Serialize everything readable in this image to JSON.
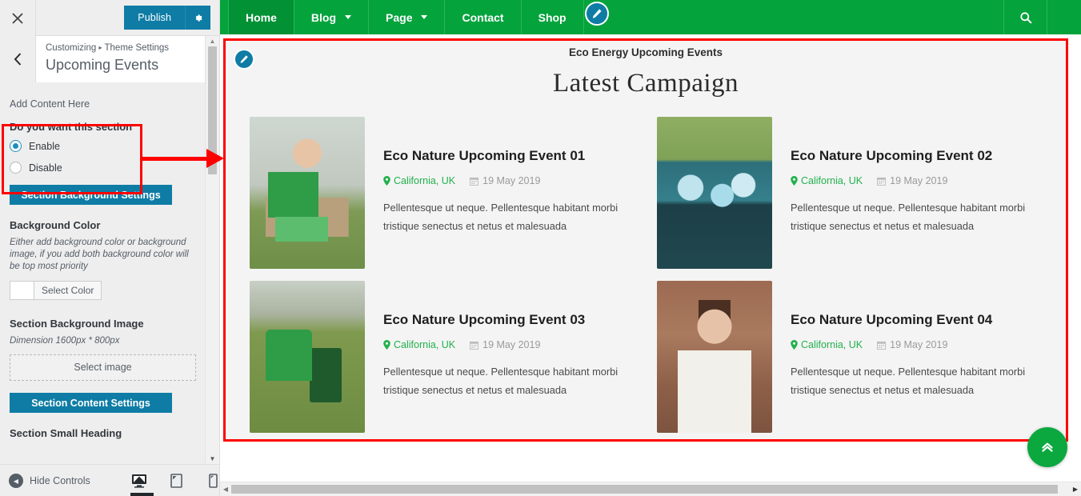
{
  "customizer": {
    "close_icon": "close-icon",
    "publish_label": "Publish",
    "gear_icon": "gear-icon",
    "back_icon": "chevron-left-icon",
    "breadcrumb_root": "Customizing",
    "breadcrumb_sep": "▸",
    "breadcrumb_parent": "Theme Settings",
    "panel_title": "Upcoming Events",
    "add_content": "Add Content Here",
    "section_toggle": {
      "label": "Do you want this section",
      "options": [
        {
          "label": "Enable",
          "selected": true
        },
        {
          "label": "Disable",
          "selected": false
        }
      ]
    },
    "background_settings_button": "Section Background Settings",
    "background_color": {
      "heading": "Background Color",
      "description": "Either add background color or background image, if you add both background color will be top most priority",
      "select_color_label": "Select Color",
      "swatch_hex": "#ffffff"
    },
    "background_image": {
      "heading": "Section Background Image",
      "dimension_note": "Dimension 1600px * 800px",
      "select_image_label": "Select image"
    },
    "content_settings_button": "Section Content Settings",
    "small_heading_label": "Section Small Heading",
    "collapse_icon": "chevron-down-icon",
    "footer": {
      "hide_controls_label": "Hide Controls",
      "hide_icon": "collapse-left-icon",
      "devices": [
        {
          "name": "desktop-preview",
          "icon": "desktop-icon",
          "active": true
        },
        {
          "name": "tablet-preview",
          "icon": "tablet-icon",
          "active": false
        },
        {
          "name": "mobile-preview",
          "icon": "mobile-icon",
          "active": false
        }
      ]
    },
    "scrollbar": {
      "up_icon": "▲",
      "down_icon": "▼"
    }
  },
  "site": {
    "nav": {
      "items": [
        {
          "label": "Home",
          "has_dropdown": false,
          "active": true
        },
        {
          "label": "Blog",
          "has_dropdown": true,
          "active": false
        },
        {
          "label": "Page",
          "has_dropdown": true,
          "active": false
        },
        {
          "label": "Contact",
          "has_dropdown": false,
          "active": false
        },
        {
          "label": "Shop",
          "has_dropdown": false,
          "active": false
        }
      ],
      "edit_icon": "pencil-edit-icon",
      "search_icon": "search-icon",
      "bar_color": "#04a33c"
    },
    "section": {
      "edit_icon": "pencil-edit-icon",
      "small_heading": "Eco Energy Upcoming Events",
      "big_heading": "Latest Campaign",
      "highlight_color": "#ff0000",
      "events": [
        {
          "title": "Eco Nature Upcoming Event 01",
          "location": "California, UK",
          "date": "19 May 2019",
          "excerpt": "Pellentesque ut neque. Pellentesque habitant morbi tristique senectus et netus et malesuada",
          "image_alt": "volunteer-holding-donations-needed-box",
          "location_icon": "map-pin-icon",
          "date_icon": "calendar-icon"
        },
        {
          "title": "Eco Nature Upcoming Event 02",
          "location": "California, UK",
          "date": "19 May 2019",
          "excerpt": "Pellentesque ut neque. Pellentesque habitant morbi tristique senectus et netus et malesuada",
          "image_alt": "gloved-hand-recycling-plastic-bottles",
          "location_icon": "map-pin-icon",
          "date_icon": "calendar-icon"
        },
        {
          "title": "Eco Nature Upcoming Event 03",
          "location": "California, UK",
          "date": "19 May 2019",
          "excerpt": "Pellentesque ut neque. Pellentesque habitant morbi tristique senectus et netus et malesuada",
          "image_alt": "volunteers-collecting-litter-in-park",
          "location_icon": "map-pin-icon",
          "date_icon": "calendar-icon"
        },
        {
          "title": "Eco Nature Upcoming Event 04",
          "location": "California, UK",
          "date": "19 May 2019",
          "excerpt": "Pellentesque ut neque. Pellentesque habitant morbi tristique senectus et netus et malesuada",
          "image_alt": "woman-holding-seedling-in-soil",
          "location_icon": "map-pin-icon",
          "date_icon": "calendar-icon"
        }
      ]
    },
    "scroll_top_icon": "double-chevron-up-icon",
    "hscroll": {
      "left_icon": "◀",
      "right_icon": "▶"
    }
  }
}
